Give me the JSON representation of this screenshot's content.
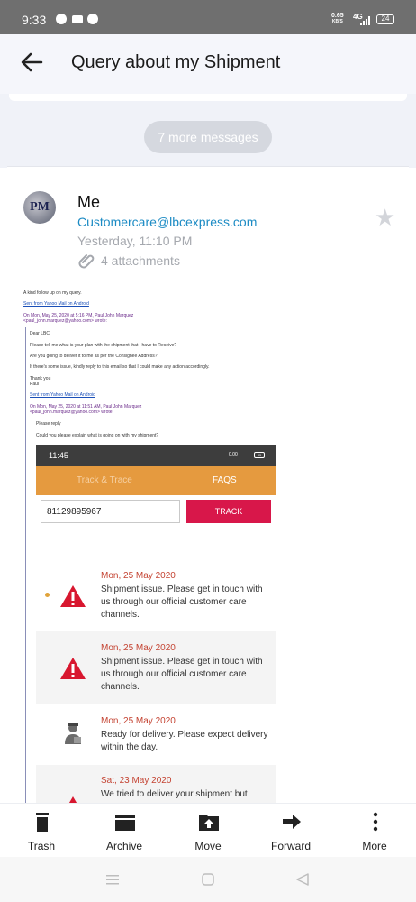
{
  "status_bar": {
    "time": "9:33",
    "net_speed": "0.65",
    "net_unit": "KB/S",
    "signal": "4G",
    "battery": "24"
  },
  "header": {
    "title": "Query about my Shipment"
  },
  "thread": {
    "more_messages": "7 more messages"
  },
  "message": {
    "avatar_initials": "PM",
    "sender": "Me",
    "recipient": "Customercare@lbcexpress.com",
    "date": "Yesterday, 11:10 PM",
    "attachments": "4 attachments"
  },
  "body": {
    "line1": "A kind follow up on my query.",
    "sent_from_1": "Sent from Yahoo Mail on Android",
    "quote_header_1a": "On Mon, May 25, 2020 at 5:16 PM, Paul John Marquez",
    "quote_header_1b": "<paul_john.marquez@yahoo.com> wrote:",
    "greeting": "Dear LBC,",
    "q1": "Please tell me what is your plan with the shipment that I have to Receive?",
    "q2": "Are you going to deliver it to me as per the Consignee Address?",
    "q3": "If there's some issue, kindly reply to this email so that I could make any action accordingly.",
    "thanks": "Thank you",
    "name": "Paul",
    "sent_from_2": "Sent from Yahoo Mail on Android",
    "quote_header_2a": "On Mon, May 25, 2020 at 11:51 AM, Paul John Marquez",
    "quote_header_2b": "<paul_john.marquez@yahoo.com> wrote:",
    "please_reply": "Please reply",
    "explain": "Could you please explain what is going on with my shipment?"
  },
  "embedded_screenshot": {
    "time": "11:45",
    "speed": "0.00",
    "battery": "85",
    "tab_track": "Track & Trace",
    "tab_faqs": "FAQS",
    "tracking_number": "81129895967",
    "track_button": "TRACK",
    "events": [
      {
        "date": "Mon, 25 May 2020",
        "message": "Shipment issue. Please get in touch with us through our official customer care channels.",
        "icon": "warning-icon"
      },
      {
        "date": "Mon, 25 May 2020",
        "message": "Shipment issue. Please get in touch with us through our official customer care channels.",
        "icon": "warning-icon"
      },
      {
        "date": "Mon, 25 May 2020",
        "message": "Ready for delivery. Please expect delivery within the day.",
        "icon": "courier-icon"
      },
      {
        "date": "Sat, 23 May 2020",
        "message": "We tried to deliver your shipment but",
        "icon": "warning-icon"
      }
    ]
  },
  "actions": {
    "trash": "Trash",
    "archive": "Archive",
    "move": "Move",
    "forward": "Forward",
    "more": "More"
  },
  "colors": {
    "link": "#1c8bc4",
    "accent_orange": "#e59a3f",
    "track_red": "#d8174a",
    "event_date": "#c44332"
  }
}
